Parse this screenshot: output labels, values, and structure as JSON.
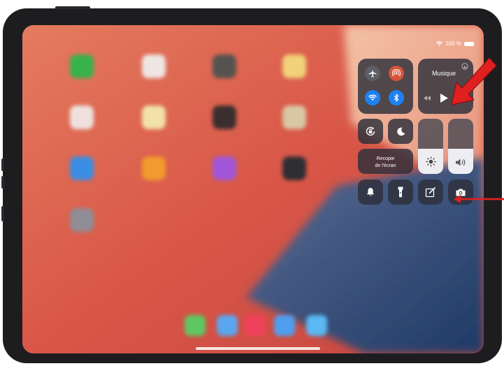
{
  "status_bar": {
    "wifi_icon": "wifi-icon",
    "battery_text": "100 %"
  },
  "control_center": {
    "connectivity": {
      "icons": [
        "airplane-icon",
        "airdrop-icon",
        "wifi-icon",
        "bluetooth-icon"
      ]
    },
    "music": {
      "title": "Musique",
      "icons": [
        "rewind-icon",
        "play-icon",
        "airplay-icon"
      ]
    },
    "rotation_lock_icon": "rotation-lock-icon",
    "do_not_disturb_icon": "moon-icon",
    "screen_mirroring": {
      "line1": "Recopie",
      "line2": "de l'écran"
    },
    "brightness": {
      "level": 0.45,
      "icon": "sun-icon"
    },
    "volume": {
      "level": 0.45,
      "icon": "speaker-icon"
    },
    "bottom_buttons": [
      "bell-icon",
      "flashlight-icon",
      "note-icon",
      "camera-icon"
    ]
  },
  "annotations": {
    "color": "#e02020"
  }
}
